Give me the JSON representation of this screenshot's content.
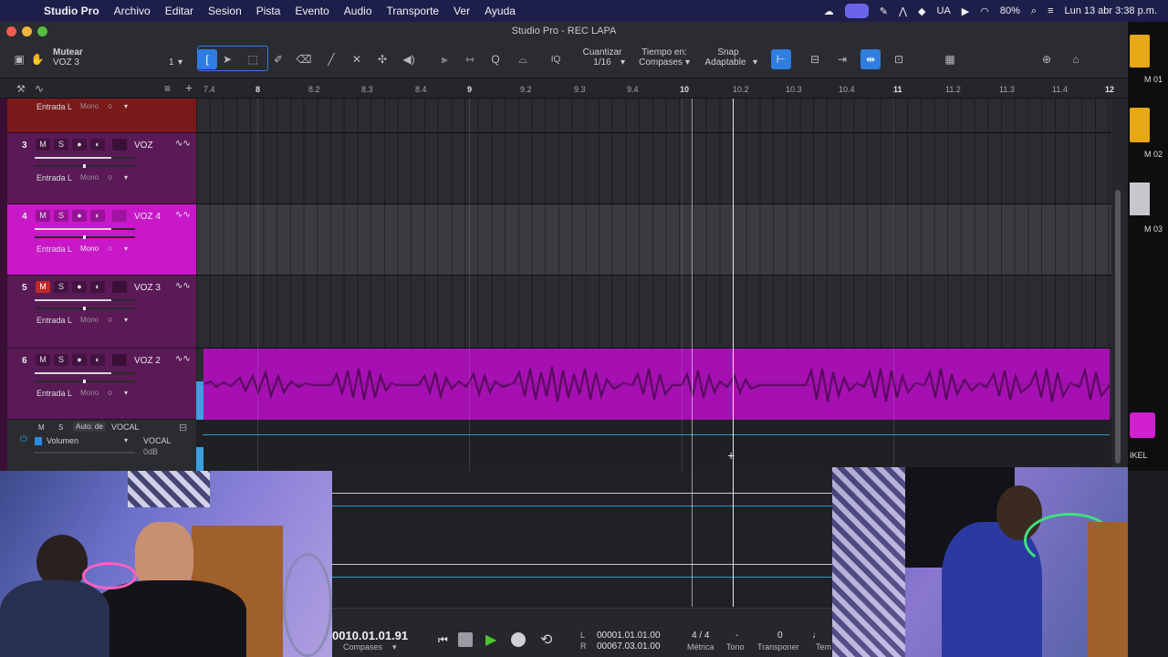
{
  "menubar": {
    "app": "Studio Pro",
    "items": [
      "Archivo",
      "Editar",
      "Sesion",
      "Pista",
      "Evento",
      "Audio",
      "Transporte",
      "Ver",
      "Ayuda"
    ],
    "input_source": "UA",
    "battery": "80%",
    "clock": "Lun 13 abr 3:38 p.m."
  },
  "window": {
    "title": "Studio Pro - REC LAPA"
  },
  "toolbar": {
    "mute_label": "Mutear",
    "track_label": "VOZ 3",
    "track_count": "1",
    "quantize_label": "Cuantizar",
    "quantize_value": "1/16",
    "timebase_label": "Tiempo en:",
    "timebase_value": "Compases",
    "snap_label": "Snap",
    "snap_value": "Adaptable",
    "iq_label": "IQ"
  },
  "ruler": {
    "labels": [
      "7.4",
      "8",
      "8.2",
      "8.3",
      "8.4",
      "9",
      "9.2",
      "9.3",
      "9.4",
      "10",
      "10.2",
      "10.3",
      "10.4",
      "11",
      "11.2",
      "11.3",
      "11.4",
      "12"
    ]
  },
  "tracks": [
    {
      "num": "",
      "name": "",
      "input": "Entrada L",
      "mode": "Mono",
      "muted": false,
      "selected": false
    },
    {
      "num": "3",
      "name": "VOZ",
      "input": "Entrada L",
      "mode": "Mono",
      "muted": false,
      "selected": false
    },
    {
      "num": "4",
      "name": "VOZ 4",
      "input": "Entrada L",
      "mode": "Mono",
      "muted": false,
      "selected": true
    },
    {
      "num": "5",
      "name": "VOZ 3",
      "input": "Entrada L",
      "mode": "Mono",
      "muted": true,
      "selected": false
    },
    {
      "num": "6",
      "name": "VOZ 2",
      "input": "Entrada L",
      "mode": "Mono",
      "muted": false,
      "selected": false
    }
  ],
  "track_buttons": {
    "mute": "M",
    "solo": "S"
  },
  "automation": {
    "mute": "M",
    "solo": "S",
    "mode": "Auto: de",
    "name": "VOCAL",
    "parameter": "Volumen",
    "target": "VOCAL",
    "value": "0dB"
  },
  "transport": {
    "time": "0010.01.01.91",
    "time_unit": "Compases",
    "loop_start": "00001.01.01.00",
    "loop_end": "00067.03.01.00",
    "loop_l": "L",
    "loop_r": "R",
    "meter": "4 / 4",
    "meter_label": "Métrica",
    "key": "-",
    "key_label": "Tono",
    "transpose": "0",
    "transpose_label": "Transponer",
    "tempo_label": "Tem"
  },
  "right_strip": {
    "labels": [
      "M 01",
      "M 02",
      "M 03",
      "IKEL"
    ]
  },
  "colors": {
    "track": "#5a1a56",
    "track_selected": "#c818c8",
    "clip": "#a610b2",
    "accent": "#2f7de0",
    "mute_active": "#c02828"
  }
}
